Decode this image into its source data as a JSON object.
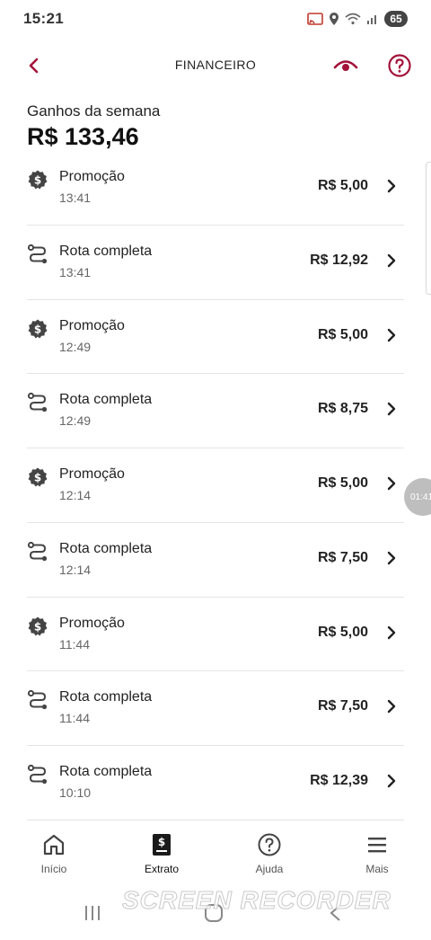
{
  "status_bar": {
    "time": "15:21",
    "battery": "65"
  },
  "header": {
    "title": "FINANCEIRO"
  },
  "summary": {
    "label": "Ganhos da semana",
    "value": "R$ 133,46"
  },
  "transactions": [
    {
      "type": "Promoção",
      "time": "13:41",
      "amount": "R$ 5,00",
      "icon": "promo-badge-icon"
    },
    {
      "type": "Rota completa",
      "time": "13:41",
      "amount": "R$ 12,92",
      "icon": "route-icon"
    },
    {
      "type": "Promoção",
      "time": "12:49",
      "amount": "R$ 5,00",
      "icon": "promo-badge-icon"
    },
    {
      "type": "Rota completa",
      "time": "12:49",
      "amount": "R$ 8,75",
      "icon": "route-icon"
    },
    {
      "type": "Promoção",
      "time": "12:14",
      "amount": "R$ 5,00",
      "icon": "promo-badge-icon"
    },
    {
      "type": "Rota completa",
      "time": "12:14",
      "amount": "R$ 7,50",
      "icon": "route-icon"
    },
    {
      "type": "Promoção",
      "time": "11:44",
      "amount": "R$ 5,00",
      "icon": "promo-badge-icon"
    },
    {
      "type": "Rota completa",
      "time": "11:44",
      "amount": "R$ 7,50",
      "icon": "route-icon"
    },
    {
      "type": "Rota completa",
      "time": "10:10",
      "amount": "R$ 12,39",
      "icon": "route-icon"
    }
  ],
  "floating_timer": "01:41",
  "bottom_nav": [
    {
      "label": "Início",
      "icon": "home-icon"
    },
    {
      "label": "Extrato",
      "icon": "statement-icon",
      "active": true
    },
    {
      "label": "Ajuda",
      "icon": "help-icon"
    },
    {
      "label": "Mais",
      "icon": "menu-icon"
    }
  ],
  "watermark": "SCREEN RECORDER",
  "colors": {
    "accent": "#a3123a",
    "text": "#222222",
    "divider": "#e4e4e4"
  }
}
